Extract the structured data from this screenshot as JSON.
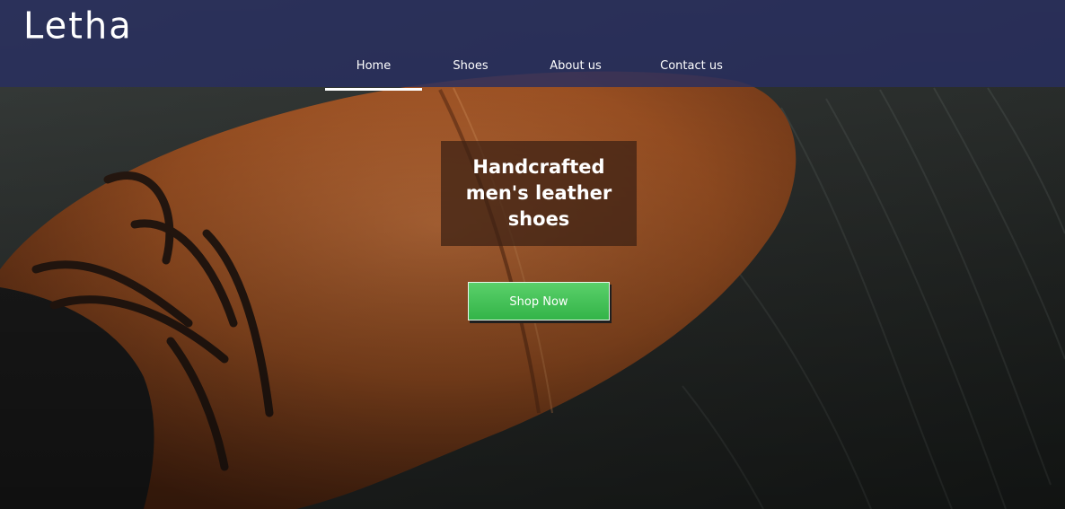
{
  "brand": {
    "logo_text": "Letha"
  },
  "nav": {
    "items": [
      {
        "label": "Home",
        "active": true
      },
      {
        "label": "Shoes",
        "active": false
      },
      {
        "label": "About us",
        "active": false
      },
      {
        "label": "Contact us",
        "active": false
      }
    ]
  },
  "hero": {
    "headline": "Handcrafted men's leather shoes",
    "cta_label": "Shop Now"
  },
  "colors": {
    "navbar_bg": "#282e60",
    "cta_green": "#3fbf53",
    "headline_box": "#3a2014",
    "leather": "#a85a2a",
    "wood": "#2d3230"
  }
}
